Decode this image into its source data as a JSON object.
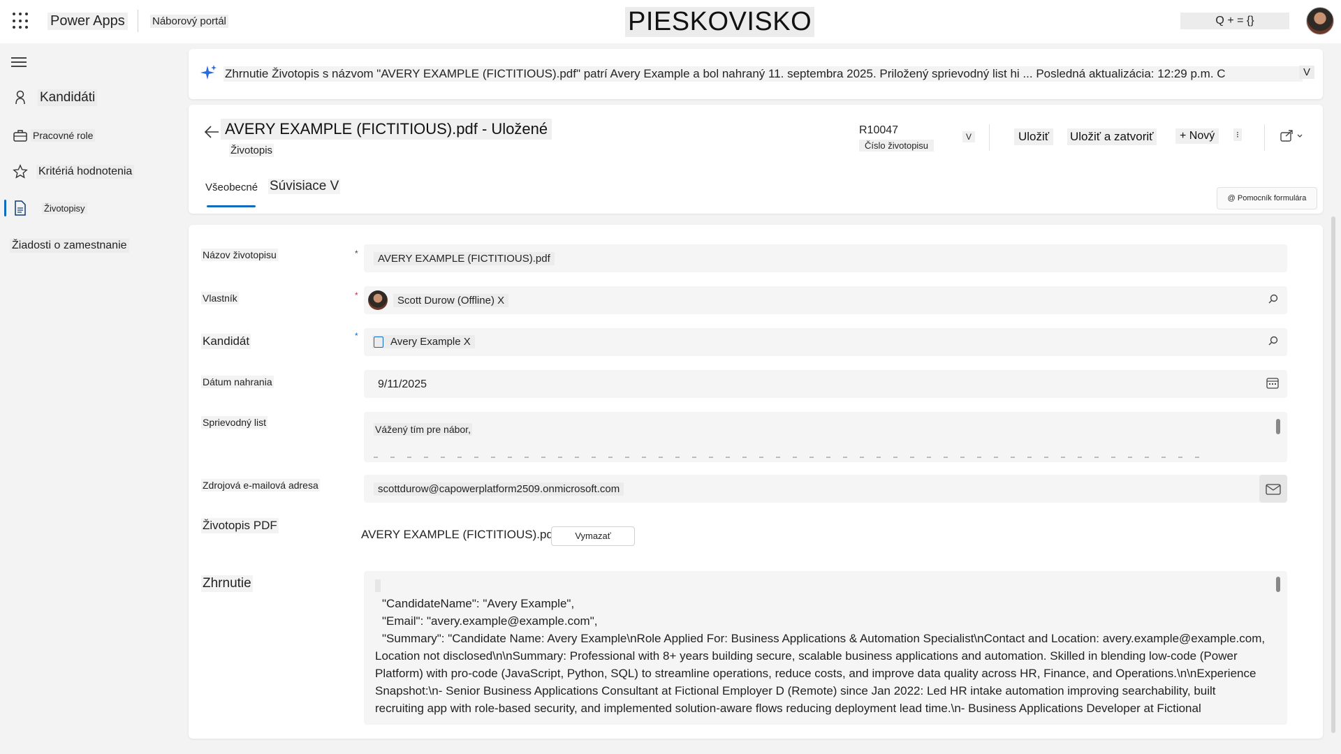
{
  "topbar": {
    "app_name": "Power Apps",
    "portal_name": "Náborový portál",
    "environment": "PIESKOVISKO",
    "search_text": "Q + = {}"
  },
  "nav": {
    "items": [
      {
        "label": "Kandidáti",
        "icon": "person-icon"
      },
      {
        "label": "Pracovné role",
        "icon": "briefcase-icon"
      },
      {
        "label": "Kritériá hodnotenia",
        "icon": "star-icon"
      },
      {
        "label": "Životopisy",
        "icon": "document-icon"
      },
      {
        "label": "Žiadosti o zamestnanie",
        "icon": ""
      }
    ]
  },
  "banner": {
    "text": "Zhrnutie Životopis s názvom \"AVERY EXAMPLE (FICTITIOUS).pdf\" patrí Avery Example a bol nahraný 11. septembra 2025. Priložený sprievodný list hi ... Posledná aktualizácia: 12:29 p.m. C",
    "chevron": "V"
  },
  "header": {
    "title": "AVERY EXAMPLE (FICTITIOUS).pdf - Uložené",
    "subtitle": "Životopis",
    "record_id": "R10047",
    "record_id_label": "Číslo životopisu",
    "chevron": "V",
    "save": "Uložiť",
    "save_close": "Uložiť a zatvoriť",
    "new": "+ Nový",
    "more": "⁝",
    "tabs": [
      "Všeobecné",
      "Súvisiace V"
    ],
    "helper": "@ Pomocník formulára"
  },
  "form": {
    "name_label": "Názov životopisu",
    "name_value": "AVERY EXAMPLE (FICTITIOUS).pdf",
    "owner_label": "Vlastník",
    "owner_value": "Scott Durow (Offline) X",
    "candidate_label": "Kandidát",
    "candidate_value": "Avery Example X",
    "date_label": "Dátum nahrania",
    "date_value": "9/11/2025",
    "cover_label": "Sprievodný list",
    "cover_value": "Vážený tím pre nábor,",
    "email_label": "Zdrojová e-mailová adresa",
    "email_value": "scottdurow@capowerplatform2509.onmicrosoft.com",
    "pdf_label": "Životopis PDF",
    "pdf_value": "AVERY EXAMPLE (FICTITIOUS).pdf",
    "delete_label": "Vymazať",
    "summary_label": "Zhrnutie",
    "summary_lines": [
      "\"CandidateName\": \"Avery Example\",",
      "\"Email\": \"avery.example@example.com\",",
      "\"Summary\": \"Candidate Name: Avery Example\\nRole Applied For: Business Applications & Automation Specialist\\nContact and Location: avery.example@example.com,",
      "Location not disclosed\\n\\nSummary: Professional with 8+ years building secure, scalable business applications and automation. Skilled in blending low-code (Power",
      "Platform) with pro-code (JavaScript, Python, SQL) to streamline operations, reduce costs, and improve data quality across HR, Finance, and Operations.\\n\\nExperience",
      "Snapshot:\\n- Senior Business Applications Consultant at Fictional Employer D (Remote) since Jan 2022: Led HR intake automation improving searchability, built",
      "recruiting app with role-based security, and implemented solution-aware flows reducing deployment lead time.\\n- Business Applications Developer at Fictional"
    ]
  }
}
